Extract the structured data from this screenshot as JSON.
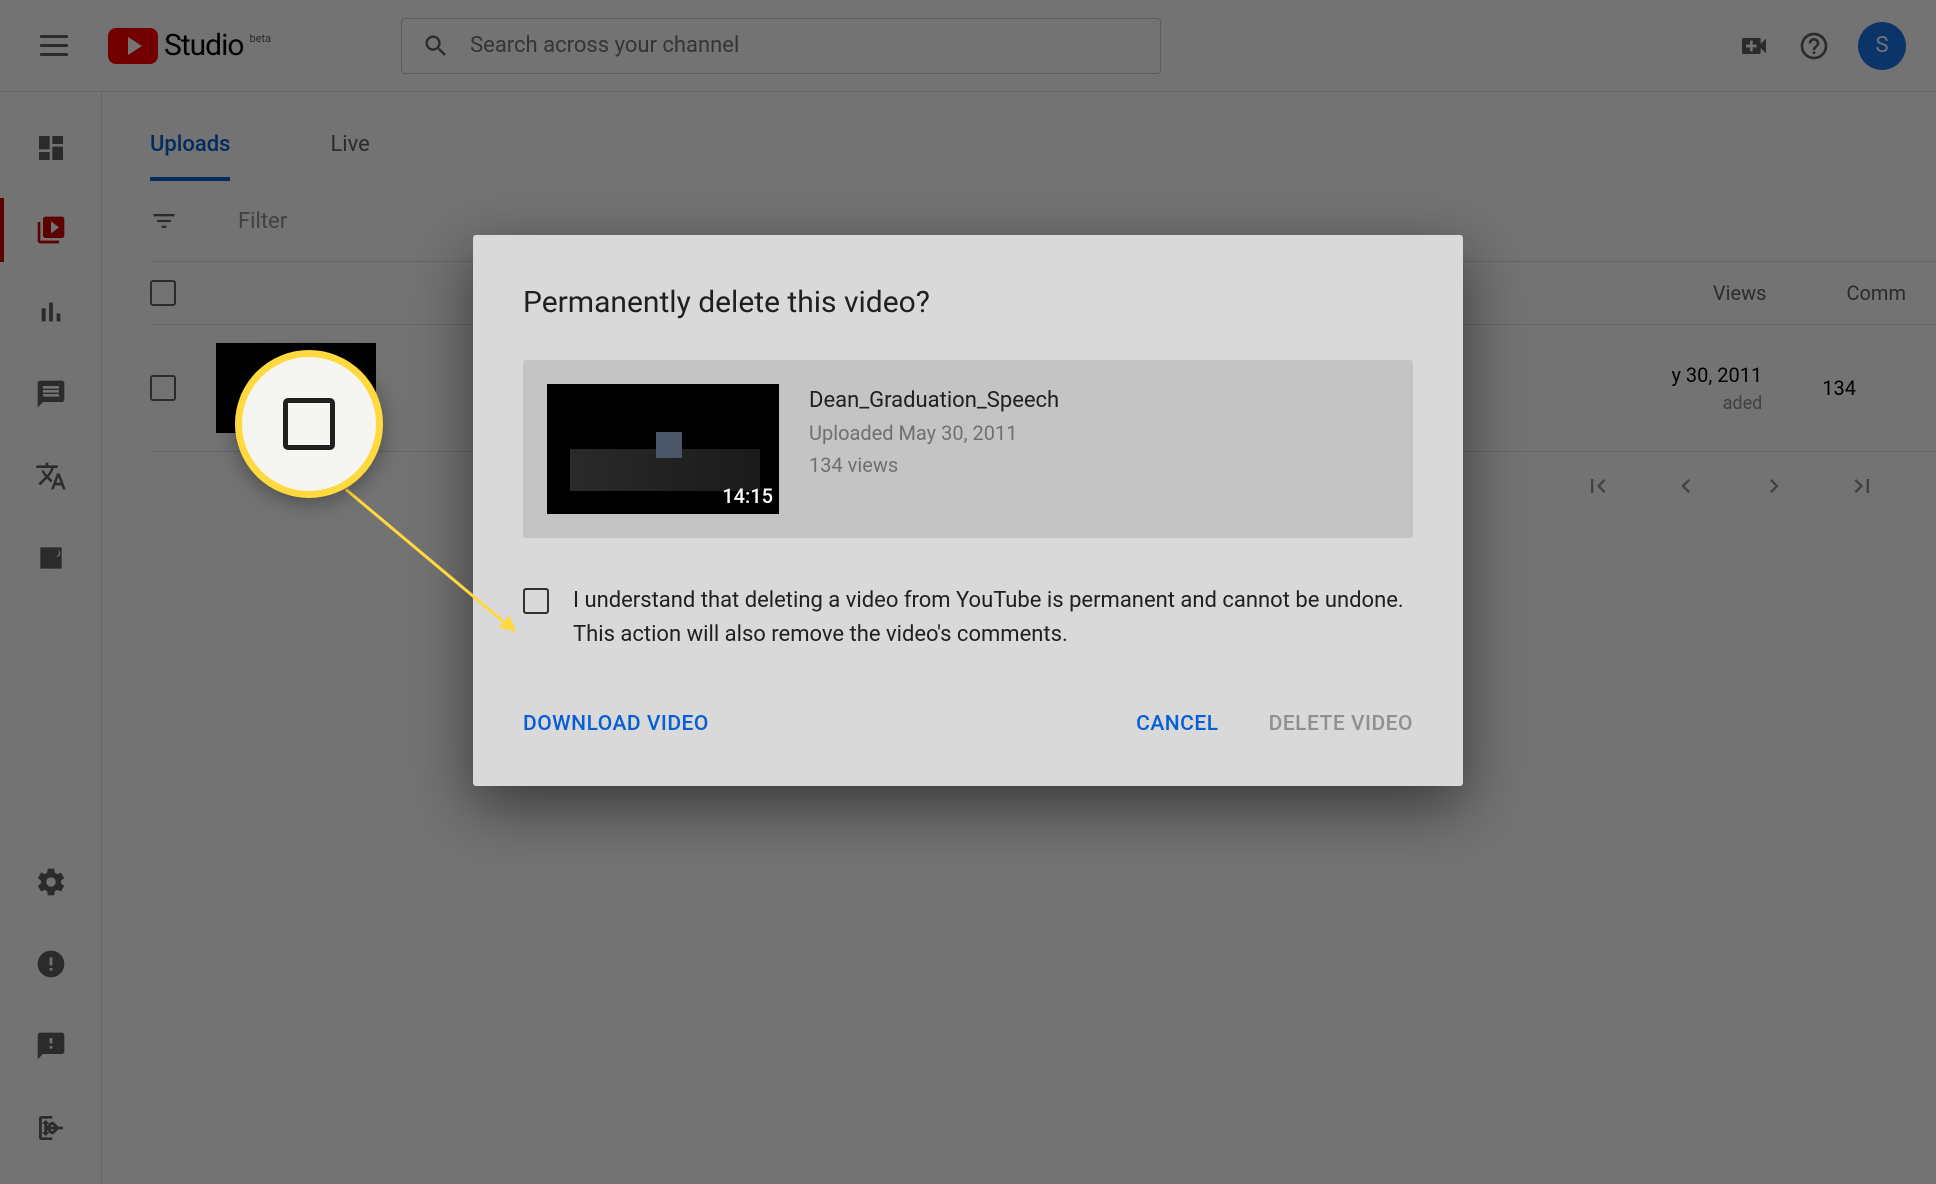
{
  "header": {
    "logo_text": "Studio",
    "logo_beta": "beta",
    "search_placeholder": "Search across your channel",
    "avatar_letter": "S"
  },
  "tabs": {
    "uploads": "Uploads",
    "live": "Live"
  },
  "filter": {
    "label": "Filter"
  },
  "columns": {
    "views": "Views",
    "comments": "Comm"
  },
  "row": {
    "date": "y 30, 2011",
    "date_sub": "aded",
    "views": "134"
  },
  "dialog": {
    "title": "Permanently delete this video?",
    "video_title": "Dean_Graduation_Speech",
    "video_uploaded": "Uploaded May 30, 2011",
    "video_views": "134 views",
    "duration": "14:15",
    "confirm_text": "I understand that deleting a video from YouTube is permanent and cannot be undone. This action will also remove the video's comments.",
    "download": "DOWNLOAD VIDEO",
    "cancel": "CANCEL",
    "delete": "DELETE VIDEO"
  }
}
